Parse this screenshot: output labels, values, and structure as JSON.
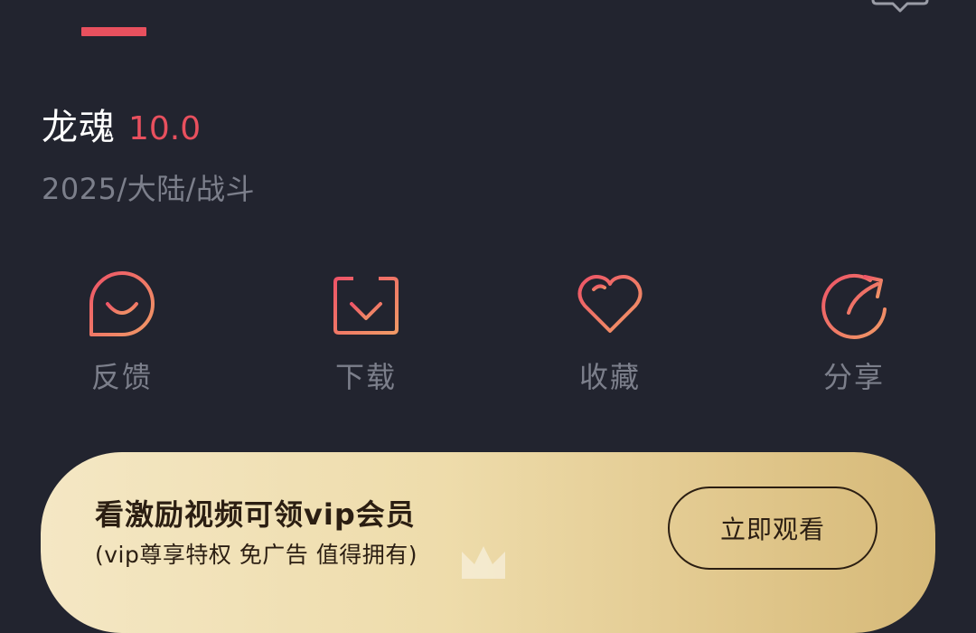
{
  "header": {
    "active_tab_indicator": "active-tab",
    "message_icon": "chat-bubble-icon"
  },
  "movie": {
    "title": "龙魂",
    "score": "10.0",
    "meta": "2025/大陆/战斗"
  },
  "actions": [
    {
      "label": "反馈",
      "icon": "smile-feedback-icon"
    },
    {
      "label": "下载",
      "icon": "download-icon"
    },
    {
      "label": "收藏",
      "icon": "heart-icon"
    },
    {
      "label": "分享",
      "icon": "share-arrow-icon"
    }
  ],
  "vip": {
    "title": "看激励视频可领vip会员",
    "subtitle": "(vip尊享特权 免广告 值得拥有)",
    "button_label": "立即观看"
  },
  "colors": {
    "background": "#22242f",
    "accent": "#e8505e",
    "muted_text": "#7c7f8b",
    "icon_gradient_start": "#ee5467",
    "icon_gradient_end": "#f19a66",
    "banner_gold": "#eedcab"
  }
}
